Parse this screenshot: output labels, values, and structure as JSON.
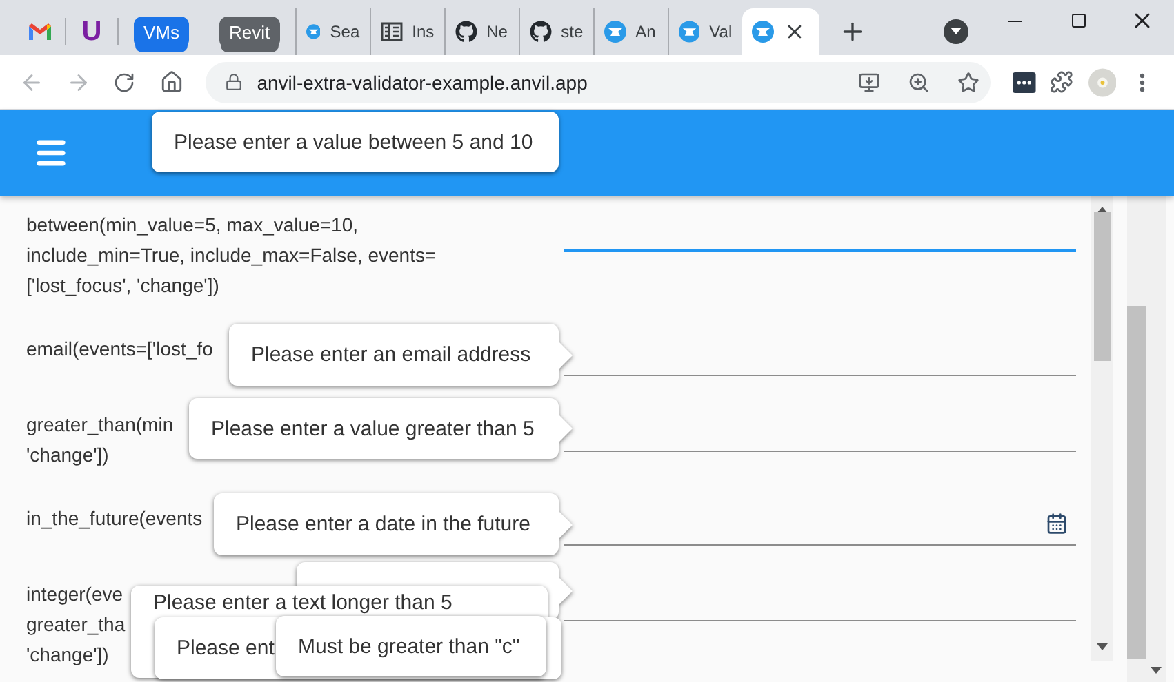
{
  "tab_strip": [
    {
      "kind": "pinned"
    },
    {
      "kind": "pinned",
      "label": "U"
    },
    {
      "kind": "group",
      "label": "VMs",
      "color": "#1a73e8"
    },
    {
      "kind": "group",
      "label": "Revit",
      "color": "#5f6368"
    },
    {
      "kind": "page",
      "title": "Sea",
      "selected": false
    },
    {
      "kind": "page",
      "title": "Ins",
      "selected": false
    },
    {
      "kind": "page",
      "title": "Ne",
      "selected": false
    },
    {
      "kind": "page",
      "title": "ste",
      "selected": false
    },
    {
      "kind": "page",
      "title": "An",
      "selected": false
    },
    {
      "kind": "page",
      "title": "Val",
      "selected": false
    },
    {
      "kind": "page",
      "selected": true
    }
  ],
  "address_bar": {
    "url": "anvil-extra-validator-example.anvil.app"
  },
  "rows": [
    {
      "lines": [
        "between(min_value=5, max_value=10,",
        "include_min=True, include_max=False, events=",
        "['lost_focus', 'change'])"
      ],
      "field": {
        "kind": "text",
        "focused": true
      }
    },
    {
      "lines": [
        "email(events=['lost_fo"
      ],
      "field": {
        "kind": "text",
        "focused": false
      }
    },
    {
      "lines": [
        "greater_than(min",
        "'change'])"
      ],
      "field": {
        "kind": "text",
        "focused": false
      }
    },
    {
      "lines": [
        "in_the_future(events"
      ],
      "field": {
        "kind": "date",
        "focused": false
      }
    },
    {
      "lines": [
        "integer(eve",
        "greater_tha",
        "'change'])"
      ],
      "field": {
        "kind": "text",
        "focused": false
      }
    }
  ],
  "tooltips": [
    {
      "text": "Please enter a value between 5 and 10"
    },
    {
      "text": "Please enter an email address"
    },
    {
      "text": "Please enter a value greater than 5"
    },
    {
      "text": "Please enter a date in the future"
    },
    {
      "text": "Please enter a text longer than 5"
    },
    {
      "text": "Please ent"
    },
    {
      "text": "Must be greater than \"c\""
    }
  ]
}
